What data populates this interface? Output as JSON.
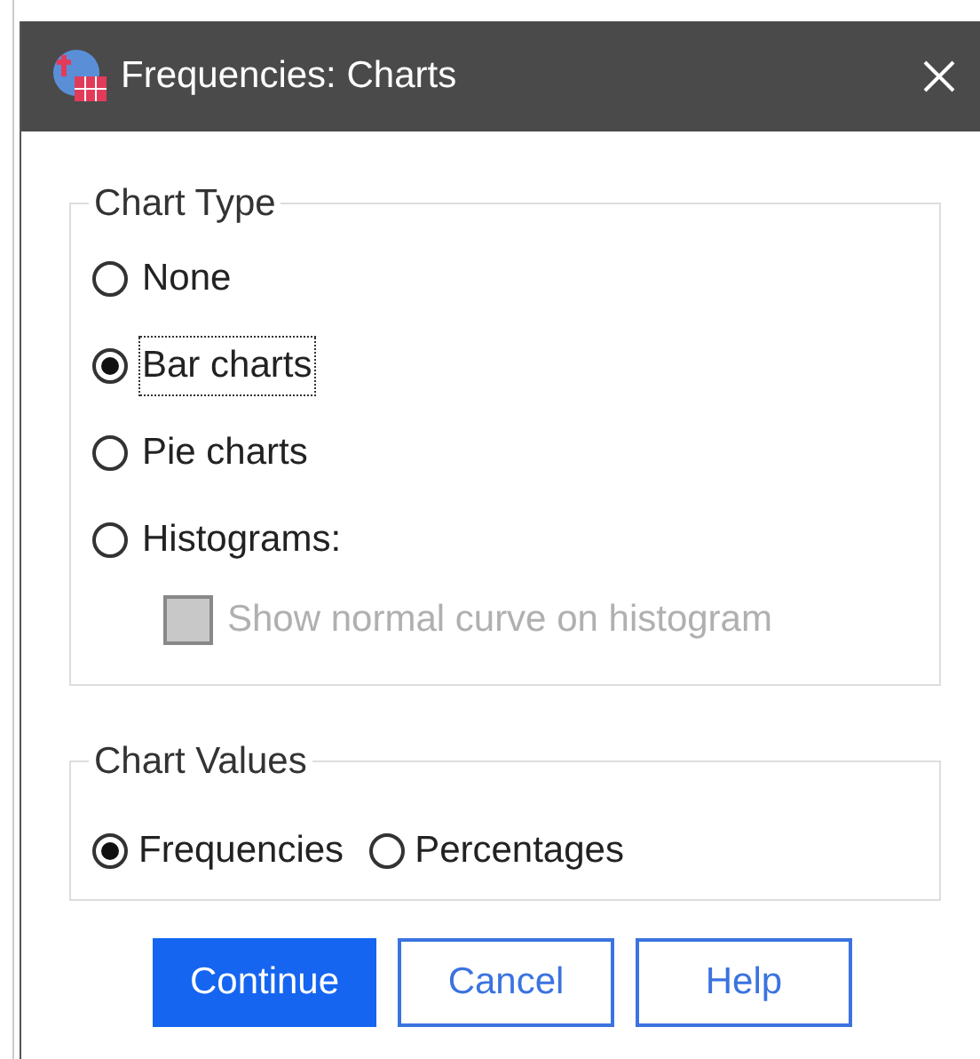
{
  "window": {
    "title": "Frequencies: Charts"
  },
  "chart_type": {
    "title": "Chart Type",
    "options": [
      {
        "label": "None",
        "selected": false,
        "focused": false
      },
      {
        "label": "Bar charts",
        "selected": true,
        "focused": true
      },
      {
        "label": "Pie charts",
        "selected": false,
        "focused": false
      },
      {
        "label": "Histograms:",
        "selected": false,
        "focused": false
      }
    ],
    "normal_curve": {
      "label": "Show normal curve on histogram",
      "checked": false,
      "disabled": true
    }
  },
  "chart_values": {
    "title": "Chart Values",
    "options": [
      {
        "label": "Frequencies",
        "selected": true
      },
      {
        "label": "Percentages",
        "selected": false
      }
    ]
  },
  "buttons": [
    {
      "label": "Continue",
      "primary": true
    },
    {
      "label": "Cancel",
      "primary": false
    },
    {
      "label": "Help",
      "primary": false
    }
  ]
}
